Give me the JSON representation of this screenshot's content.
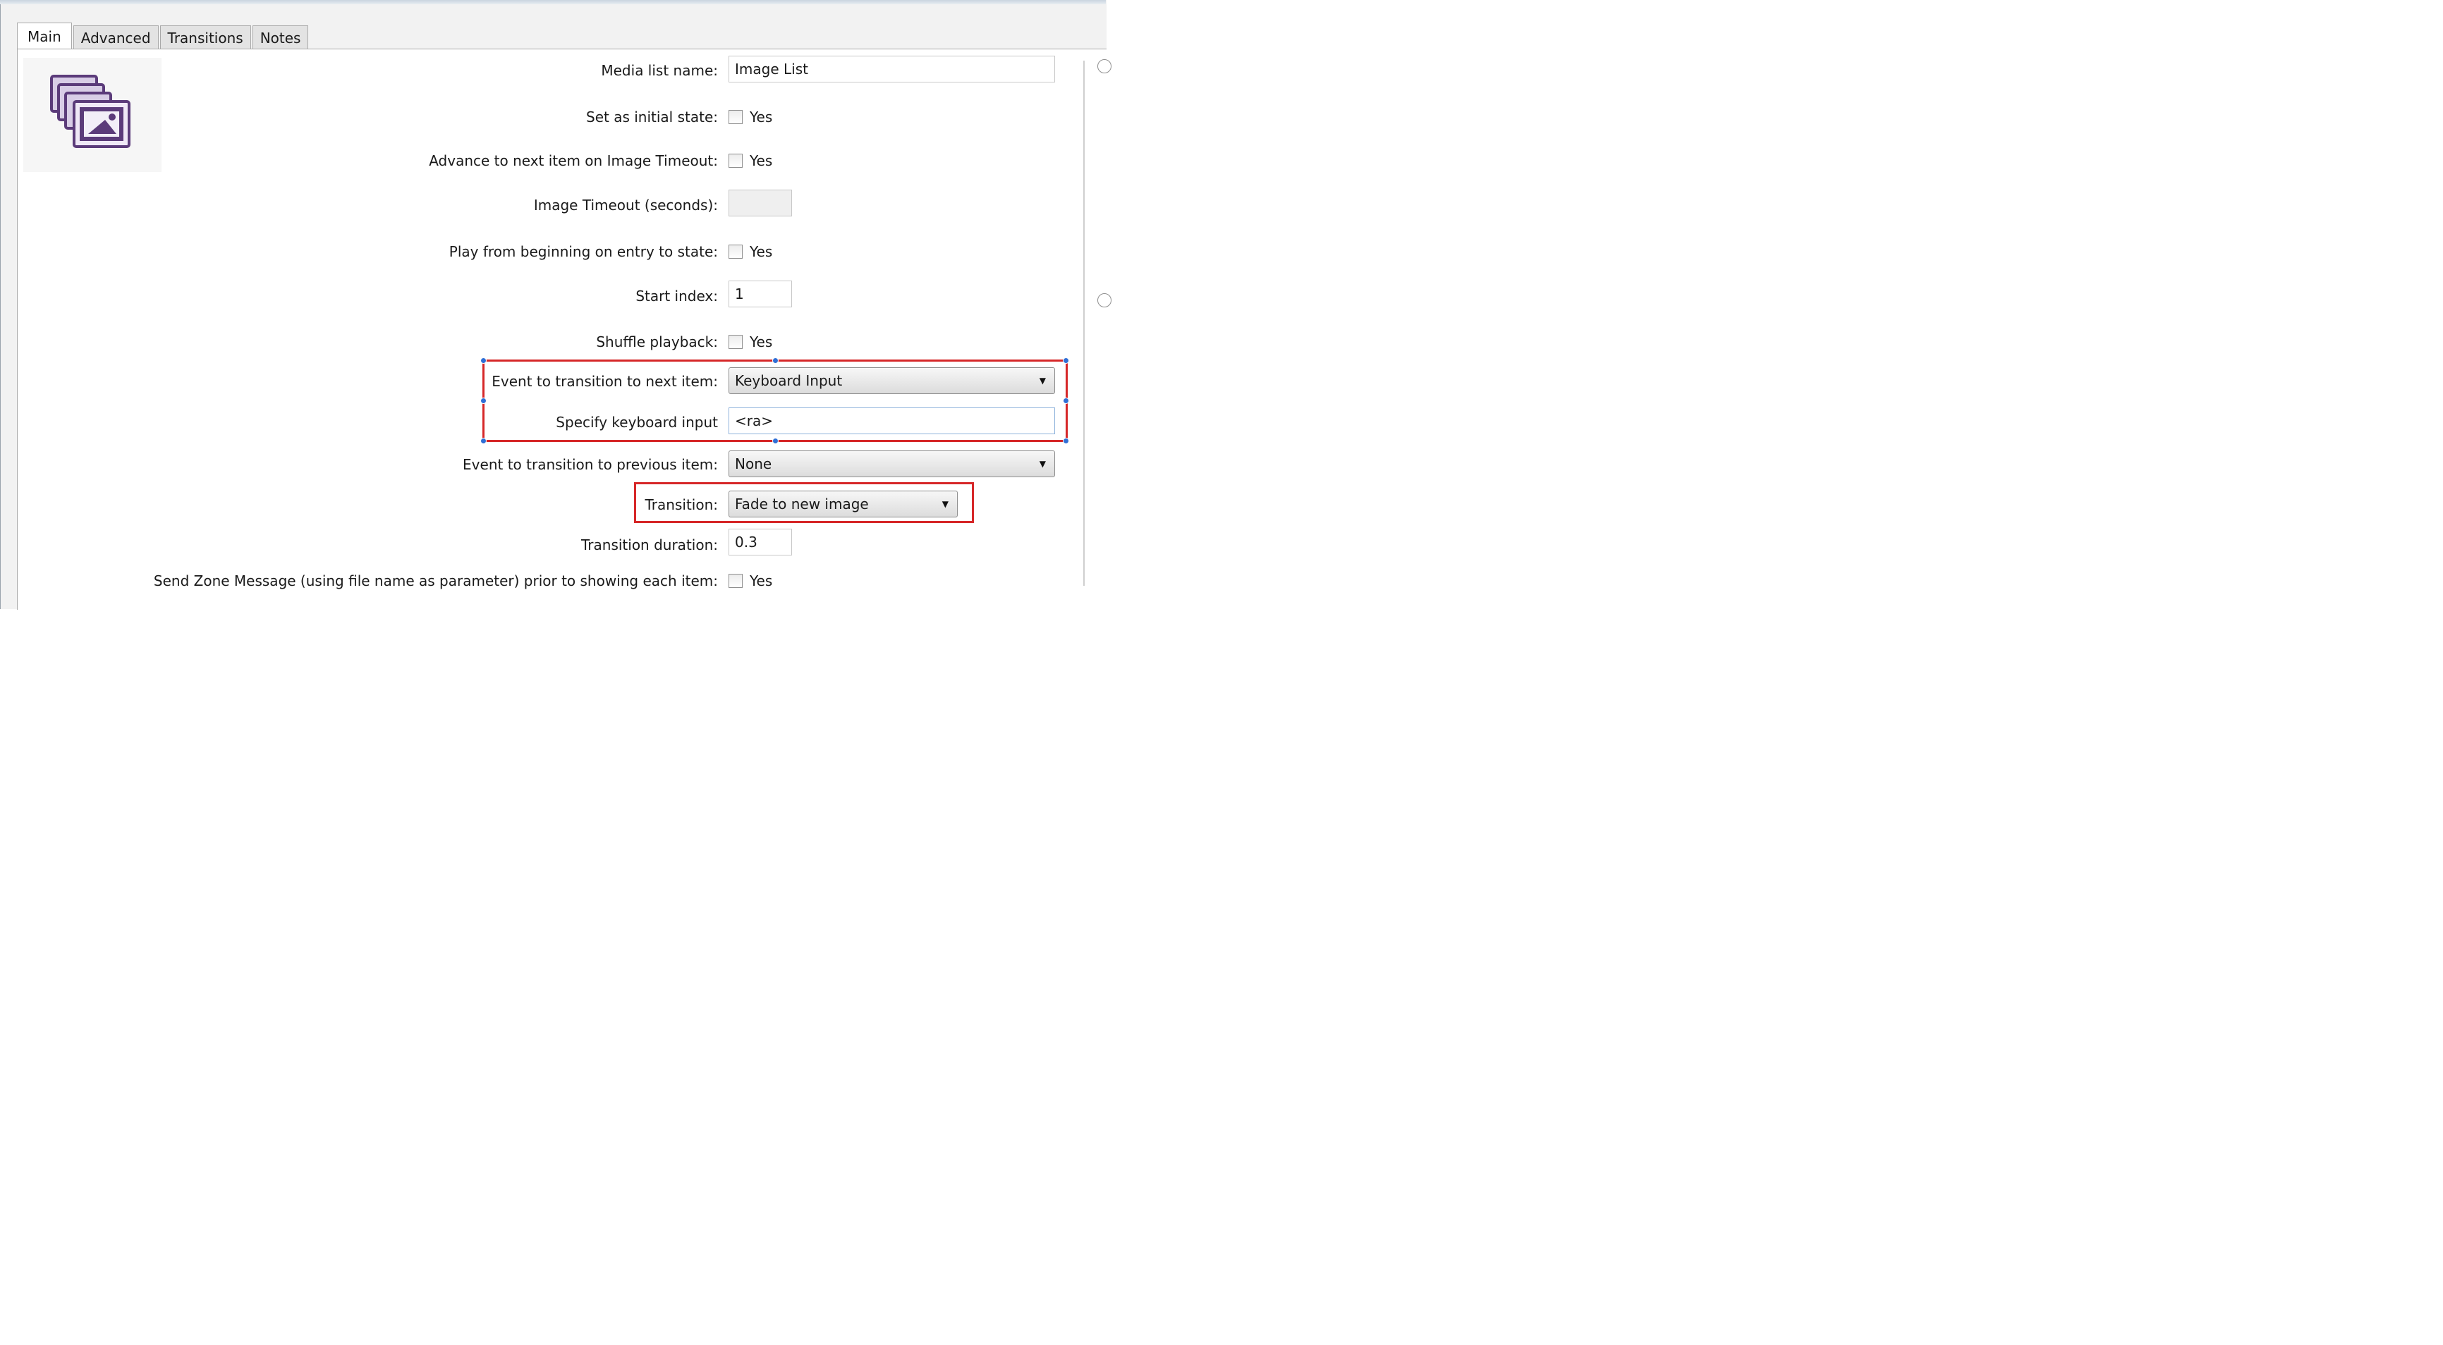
{
  "tabs": [
    "Main",
    "Advanced",
    "Transitions",
    "Notes"
  ],
  "active_tab": "Main",
  "icons": {
    "media_list": "stacked-images-icon",
    "dropdown": "chevron-down-icon"
  },
  "form": {
    "media_list_name": {
      "label": "Media list name:",
      "value": "Image List"
    },
    "set_initial_state": {
      "label": "Set as initial state:",
      "option": "Yes",
      "checked": false
    },
    "advance_on_timeout": {
      "label": "Advance to next item on Image Timeout:",
      "option": "Yes",
      "checked": false
    },
    "image_timeout": {
      "label": "Image Timeout (seconds):",
      "value": ""
    },
    "play_from_beginning": {
      "label": "Play from beginning on entry to state:",
      "option": "Yes",
      "checked": false
    },
    "start_index": {
      "label": "Start index:",
      "value": "1"
    },
    "shuffle_playback": {
      "label": "Shuffle playback:",
      "option": "Yes",
      "checked": false
    },
    "event_next": {
      "label": "Event to transition to next item:",
      "value": "Keyboard Input"
    },
    "keyboard_input": {
      "label": "Specify keyboard input",
      "value": "<ra>"
    },
    "event_previous": {
      "label": "Event to transition to previous item:",
      "value": "None"
    },
    "transition": {
      "label": "Transition:",
      "value": "Fade to new image"
    },
    "transition_duration": {
      "label": "Transition duration:",
      "value": "0.3"
    },
    "send_zone_message": {
      "label": "Send Zone Message (using file name as parameter) prior to showing each item:",
      "option": "Yes",
      "checked": false
    }
  },
  "colors": {
    "highlight": "#d62728",
    "handle": "#2f6fd6",
    "focus_border": "#8fb3dc"
  }
}
